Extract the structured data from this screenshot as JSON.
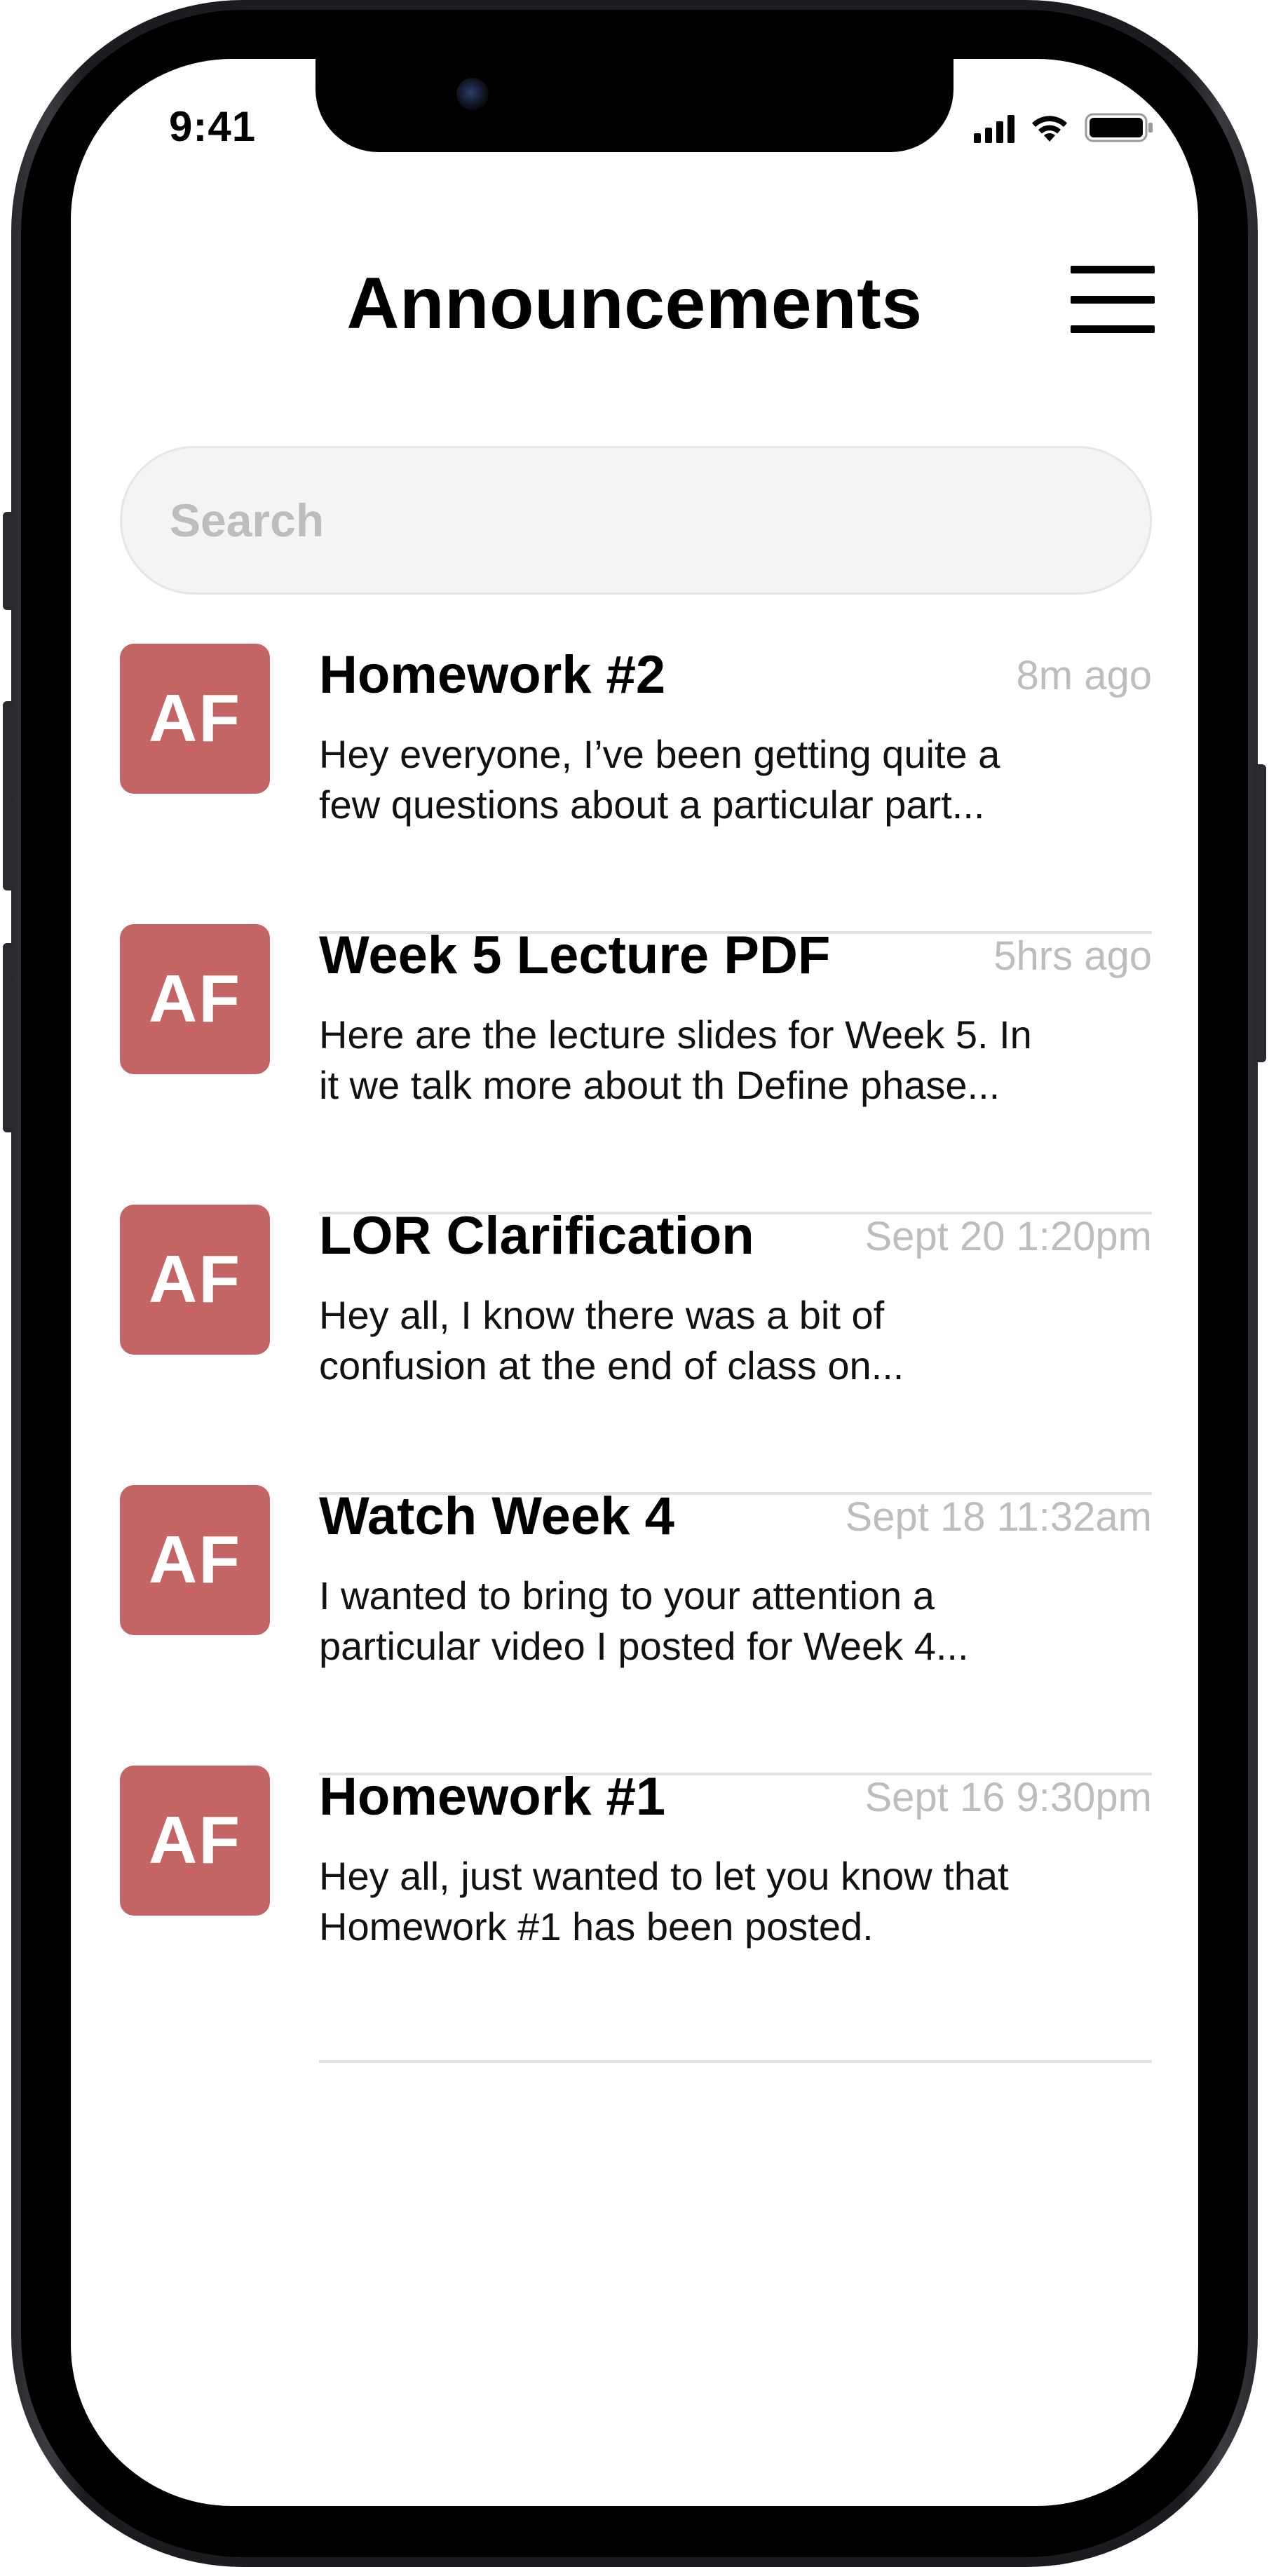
{
  "status_bar": {
    "time": "9:41",
    "signal_icon": "cellular-signal-icon",
    "wifi_icon": "wifi-icon",
    "battery_icon": "battery-icon"
  },
  "header": {
    "title": "Announcements",
    "menu_icon": "hamburger-menu-icon"
  },
  "search": {
    "placeholder": "Search"
  },
  "announcements": [
    {
      "avatar": "AF",
      "title": "Homework #2",
      "time": "8m ago",
      "preview_line1": "Hey everyone, I’ve been getting quite a",
      "preview_line2": "few questions about a particular part..."
    },
    {
      "avatar": "AF",
      "title": "Week 5 Lecture PDF",
      "time": "5hrs ago",
      "preview_line1": "Here are the lecture slides for Week 5. In",
      "preview_line2": "it we talk more about th Define phase..."
    },
    {
      "avatar": "AF",
      "title": "LOR Clarification",
      "time": "Sept 20 1:20pm",
      "preview_line1": "Hey all, I know there was a bit of",
      "preview_line2": "confusion at the end of class on..."
    },
    {
      "avatar": "AF",
      "title": "Watch Week 4",
      "time": "Sept 18 11:32am",
      "preview_line1": "I wanted to bring to your attention a",
      "preview_line2": "particular video I posted for Week 4..."
    },
    {
      "avatar": "AF",
      "title": "Homework #1",
      "time": "Sept 16 9:30pm",
      "preview_line1": "Hey all, just wanted to let you know that",
      "preview_line2": "Homework #1 has been posted."
    }
  ],
  "colors": {
    "avatar_background": "#c46464",
    "timestamp": "#bdbdbd",
    "divider": "#e2e2e2",
    "search_background": "#f4f4f4"
  }
}
